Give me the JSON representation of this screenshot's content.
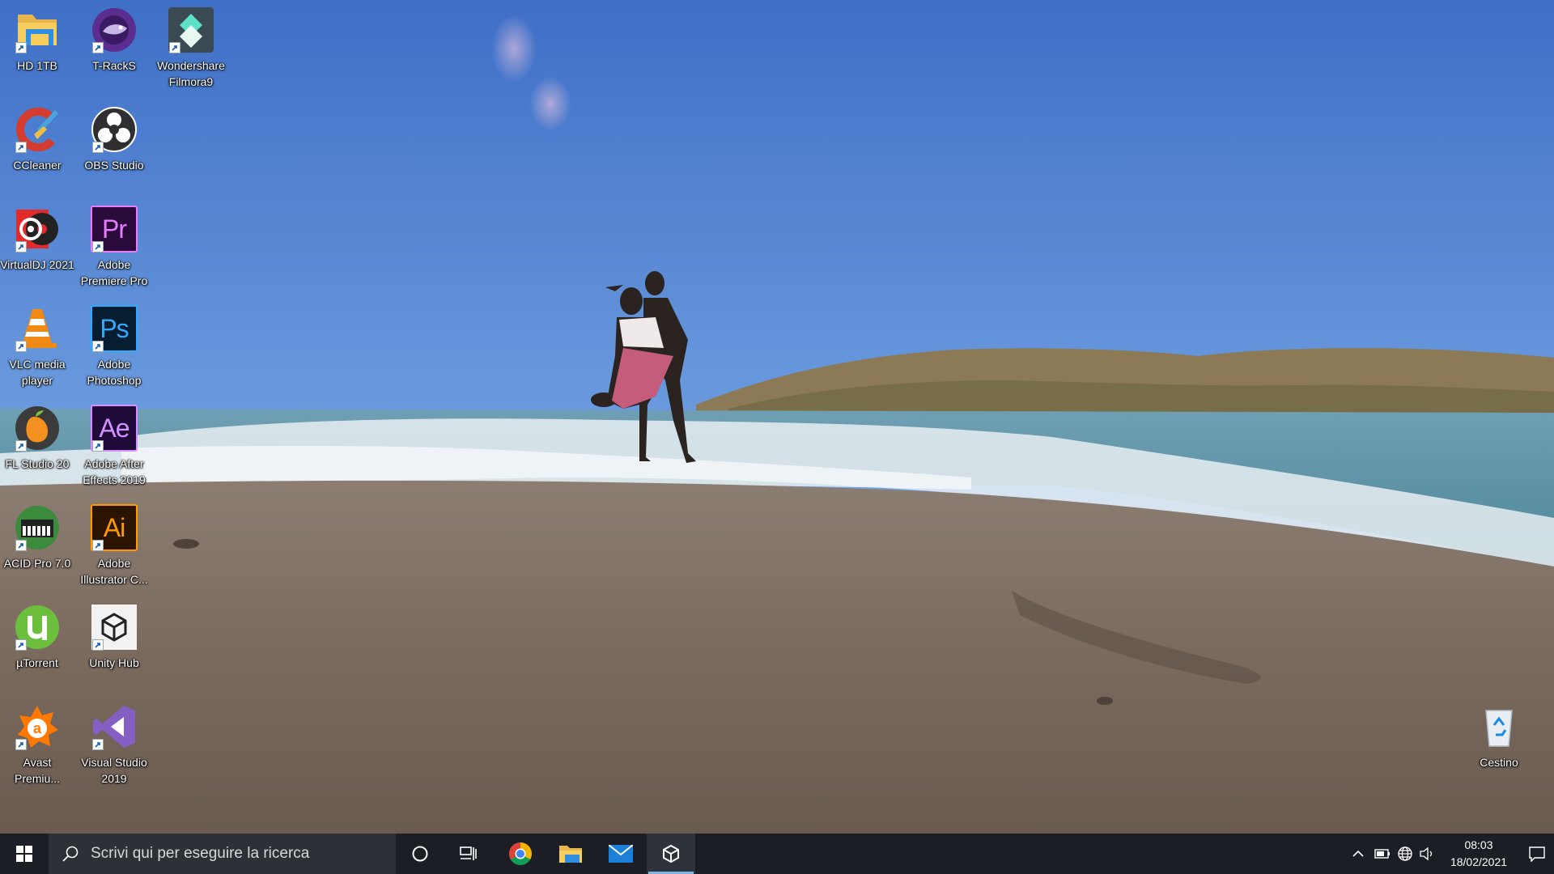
{
  "desktop": {
    "icons": [
      {
        "id": "hd1tb",
        "label": "HD 1TB",
        "icon": "folder-drive-icon"
      },
      {
        "id": "tracks",
        "label": "T-RackS",
        "icon": "t-racks-icon"
      },
      {
        "id": "filmora",
        "label": "Wondershare Filmora9",
        "icon": "filmora-icon"
      },
      {
        "id": "ccleaner",
        "label": "CCleaner",
        "icon": "ccleaner-icon"
      },
      {
        "id": "obs",
        "label": "OBS Studio",
        "icon": "obs-icon"
      },
      {
        "id": "virtualdj",
        "label": "VirtualDJ 2021",
        "icon": "virtualdj-icon"
      },
      {
        "id": "premiere",
        "label": "Adobe Premiere Pro",
        "icon": "premiere-icon",
        "tile_text": "Pr"
      },
      {
        "id": "vlc",
        "label": "VLC media player",
        "icon": "vlc-cone-icon"
      },
      {
        "id": "photoshop",
        "label": "Adobe Photoshop",
        "icon": "photoshop-icon",
        "tile_text": "Ps"
      },
      {
        "id": "flstudio",
        "label": "FL Studio 20",
        "icon": "fl-studio-icon"
      },
      {
        "id": "aftereffects",
        "label": "Adobe After Effects 2019",
        "icon": "after-effects-icon",
        "tile_text": "Ae"
      },
      {
        "id": "acid",
        "label": "ACID Pro 7.0",
        "icon": "acid-pro-icon"
      },
      {
        "id": "illustrator",
        "label": "Adobe Illustrator C...",
        "icon": "illustrator-icon",
        "tile_text": "Ai"
      },
      {
        "id": "utorrent",
        "label": "µTorrent",
        "icon": "utorrent-icon"
      },
      {
        "id": "unityhub",
        "label": "Unity Hub",
        "icon": "unity-icon"
      },
      {
        "id": "avast",
        "label": "Avast Premiu...",
        "icon": "avast-icon"
      },
      {
        "id": "vstudio",
        "label": "Visual Studio 2019",
        "icon": "visual-studio-icon"
      },
      {
        "id": "recycle",
        "label": "Cestino",
        "icon": "recycle-bin-icon"
      }
    ]
  },
  "taskbar": {
    "search_placeholder": "Scrivi qui per eseguire la ricerca",
    "pinned": [
      "cortana-icon",
      "task-view-icon",
      "chrome-icon",
      "file-explorer-icon",
      "mail-icon",
      "unity-icon"
    ],
    "time": "08:03",
    "date": "18/02/2021"
  },
  "colors": {
    "taskbar_bg": "#1b1e24",
    "search_bg": "#2d3036",
    "accent": "#7fb4e8"
  }
}
